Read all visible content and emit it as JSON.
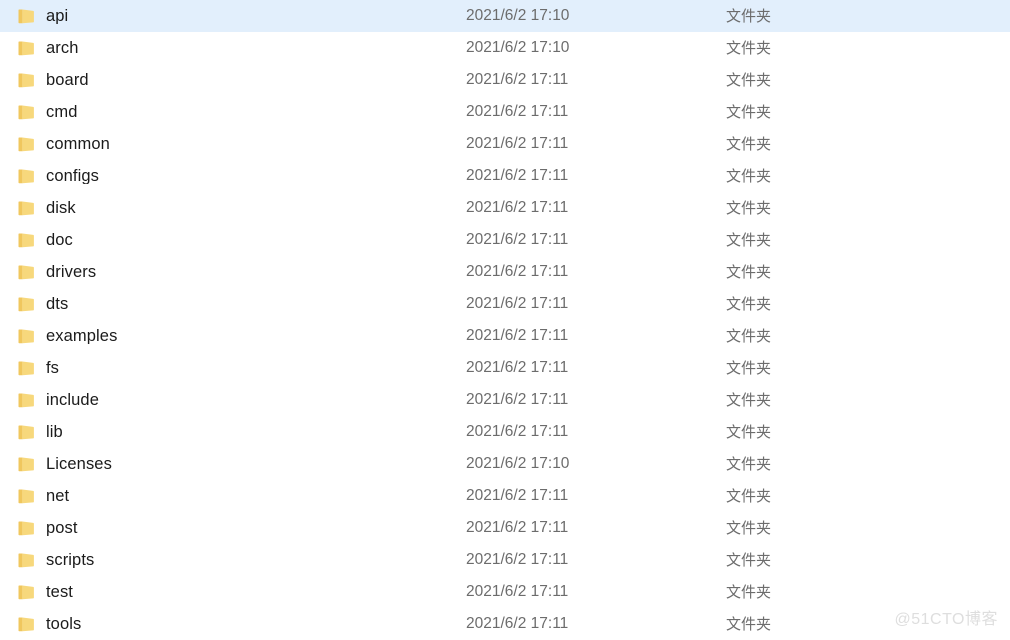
{
  "window": {
    "view_mode": "details-list",
    "selected_index": 0
  },
  "colors": {
    "selection_background": "#e2effc",
    "folder_icon_fill": "#f7d87c",
    "folder_icon_tab": "#f0c75e",
    "name_text": "#1b1b1b",
    "meta_text": "#6c6c6c",
    "watermark_text": "#dedede",
    "background": "#ffffff"
  },
  "columns": {
    "name": "name",
    "date_modified": "date_modified",
    "type": "type"
  },
  "icons": {
    "folder": "folder-icon"
  },
  "watermark": {
    "text": "@51CTO博客"
  },
  "rows": [
    {
      "name": "api",
      "date_modified": "2021/6/2 17:10",
      "type": "文件夹",
      "icon": "folder-icon",
      "selected": true
    },
    {
      "name": "arch",
      "date_modified": "2021/6/2 17:10",
      "type": "文件夹",
      "icon": "folder-icon",
      "selected": false
    },
    {
      "name": "board",
      "date_modified": "2021/6/2 17:11",
      "type": "文件夹",
      "icon": "folder-icon",
      "selected": false
    },
    {
      "name": "cmd",
      "date_modified": "2021/6/2 17:11",
      "type": "文件夹",
      "icon": "folder-icon",
      "selected": false
    },
    {
      "name": "common",
      "date_modified": "2021/6/2 17:11",
      "type": "文件夹",
      "icon": "folder-icon",
      "selected": false
    },
    {
      "name": "configs",
      "date_modified": "2021/6/2 17:11",
      "type": "文件夹",
      "icon": "folder-icon",
      "selected": false
    },
    {
      "name": "disk",
      "date_modified": "2021/6/2 17:11",
      "type": "文件夹",
      "icon": "folder-icon",
      "selected": false
    },
    {
      "name": "doc",
      "date_modified": "2021/6/2 17:11",
      "type": "文件夹",
      "icon": "folder-icon",
      "selected": false
    },
    {
      "name": "drivers",
      "date_modified": "2021/6/2 17:11",
      "type": "文件夹",
      "icon": "folder-icon",
      "selected": false
    },
    {
      "name": "dts",
      "date_modified": "2021/6/2 17:11",
      "type": "文件夹",
      "icon": "folder-icon",
      "selected": false
    },
    {
      "name": "examples",
      "date_modified": "2021/6/2 17:11",
      "type": "文件夹",
      "icon": "folder-icon",
      "selected": false
    },
    {
      "name": "fs",
      "date_modified": "2021/6/2 17:11",
      "type": "文件夹",
      "icon": "folder-icon",
      "selected": false
    },
    {
      "name": "include",
      "date_modified": "2021/6/2 17:11",
      "type": "文件夹",
      "icon": "folder-icon",
      "selected": false
    },
    {
      "name": "lib",
      "date_modified": "2021/6/2 17:11",
      "type": "文件夹",
      "icon": "folder-icon",
      "selected": false
    },
    {
      "name": "Licenses",
      "date_modified": "2021/6/2 17:10",
      "type": "文件夹",
      "icon": "folder-icon",
      "selected": false
    },
    {
      "name": "net",
      "date_modified": "2021/6/2 17:11",
      "type": "文件夹",
      "icon": "folder-icon",
      "selected": false
    },
    {
      "name": "post",
      "date_modified": "2021/6/2 17:11",
      "type": "文件夹",
      "icon": "folder-icon",
      "selected": false
    },
    {
      "name": "scripts",
      "date_modified": "2021/6/2 17:11",
      "type": "文件夹",
      "icon": "folder-icon",
      "selected": false
    },
    {
      "name": "test",
      "date_modified": "2021/6/2 17:11",
      "type": "文件夹",
      "icon": "folder-icon",
      "selected": false
    },
    {
      "name": "tools",
      "date_modified": "2021/6/2 17:11",
      "type": "文件夹",
      "icon": "folder-icon",
      "selected": false
    }
  ]
}
